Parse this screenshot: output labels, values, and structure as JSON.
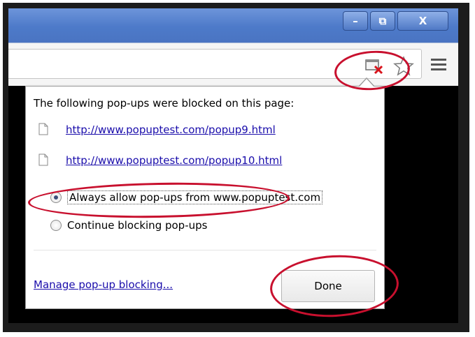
{
  "window": {
    "minimize_glyph": "–",
    "maximize_glyph": "⧉",
    "close_glyph": "X"
  },
  "bubble": {
    "heading": "The following pop-ups were blocked on this page:",
    "links": [
      "http://www.popuptest.com/popup9.html",
      "http://www.popuptest.com/popup10.html"
    ],
    "options": [
      "Always allow pop-ups from www.popuptest.com",
      "Continue blocking pop-ups"
    ],
    "selected_option": 0,
    "manage_link": "Manage pop-up blocking...",
    "done_label": "Done"
  },
  "colors": {
    "annotation": "#c8102e",
    "link": "#1a0dab",
    "titlebar": "#4d7ac9"
  },
  "icons": [
    "popup-blocked-icon",
    "star-icon",
    "menu-icon",
    "file-icon"
  ]
}
